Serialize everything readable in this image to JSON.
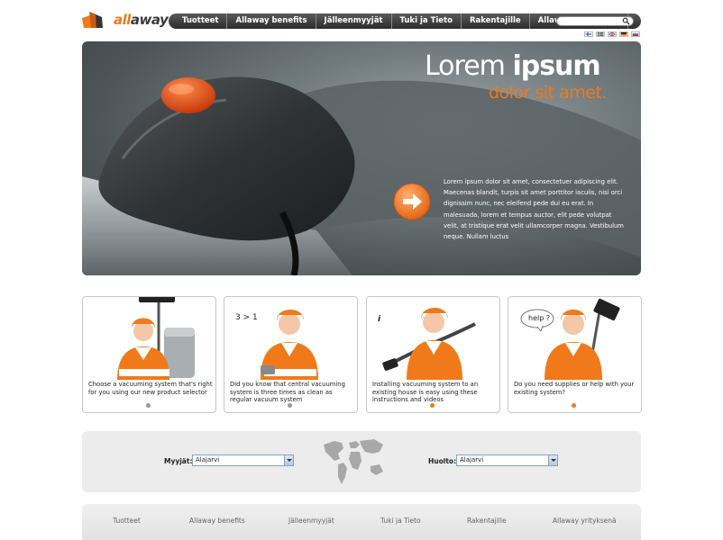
{
  "brand": {
    "part1": "all",
    "part2": "away"
  },
  "nav": {
    "items": [
      "Tuotteet",
      "Allaway benefits",
      "Jälleenmyyjät",
      "Tuki ja Tieto",
      "Rakentajille",
      "Allaway yrityksenä"
    ],
    "search_value": ""
  },
  "languages": [
    "fi",
    "sv",
    "en",
    "de",
    "ru"
  ],
  "hero": {
    "title_light": "Lorem ",
    "title_bold": "ipsum",
    "subtitle": "dolor sit amet.",
    "body": "Lorem ipsum dolor sit amet, consectetuer adipiscing elit. Maecenas blandit, turpis sit amet porttitor iaculis, nisi orci dignissim nunc, nec eleifend pede dui eu erat. In malesuada, lorem et tempus auctor, elit pede volutpat velit, at tristique erat velit ullamcorper magna. Vestibulum neque. Nullam luctus"
  },
  "cards": [
    {
      "text": "Choose a vacuuming system that's right for you using our new product selector",
      "badge": "",
      "dot_active": false
    },
    {
      "text": "Did you know that central vacuuming system is three times as clean as regular vacuum system",
      "badge": "3 > 1",
      "dot_active": false
    },
    {
      "text": "Installing vacuuming system to an existing house is easy using these instructions and videos",
      "badge": "i",
      "dot_active": true
    },
    {
      "text": "Do you need supplies or help with your existing system?",
      "badge": "help ?",
      "dot_active": true
    }
  ],
  "dealer": {
    "dealers_label": "Myyjät:",
    "dealers_value": "Alajarvi",
    "service_label": "Huolto:",
    "service_value": "Alajarvi"
  },
  "footer": {
    "links": [
      "Tuotteet",
      "Allaway benefits",
      "Jälleenmyyjät",
      "Tuki ja Tieto",
      "Rakentajille",
      "Allaway yrityksenä"
    ]
  },
  "colors": {
    "accent": "#f07a1a",
    "nav_dark": "#2c2c2c",
    "dot_inactive": "#999999"
  }
}
